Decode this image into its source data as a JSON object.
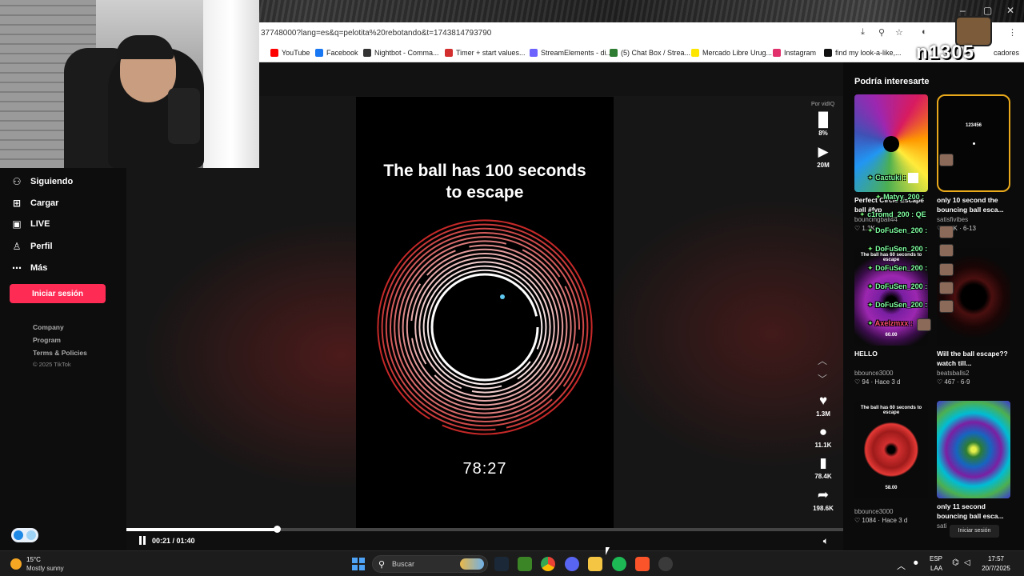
{
  "browser": {
    "address": "37748000?lang=es&q=pelotita%20rebotando&t=1743814793790",
    "bookmarks": [
      {
        "label": "YouTube",
        "color": "#ff0000"
      },
      {
        "label": "Facebook",
        "color": "#1877f2"
      },
      {
        "label": "Nightbot - Comma...",
        "color": "#333333"
      },
      {
        "label": "Timer + start values...",
        "color": "#d32f2f"
      },
      {
        "label": "StreamElements - di...",
        "color": "#6c63ff"
      },
      {
        "label": "(5) Chat Box / Strea...",
        "color": "#2e7d32"
      },
      {
        "label": "Mercado Libre Urug...",
        "color": "#ffe600"
      },
      {
        "label": "Instagram",
        "color": "#e1306c"
      },
      {
        "label": "find my look-a-like,...",
        "color": "#111111"
      }
    ],
    "bookmarks_overflow": "»",
    "bookmarks_folder": "cadores"
  },
  "stream_overlay": {
    "brand": "n1305"
  },
  "sidebar": {
    "items": [
      {
        "label": "Siguiendo",
        "icon": "user-icon"
      },
      {
        "label": "Cargar",
        "icon": "plus-box-icon"
      },
      {
        "label": "LIVE",
        "icon": "live-tv-icon"
      },
      {
        "label": "Perfil",
        "icon": "person-icon"
      },
      {
        "label": "Más",
        "icon": "more-icon"
      }
    ],
    "login_button": "Iniciar sesión",
    "footer_links": [
      "Company",
      "Program",
      "Terms & Policies"
    ],
    "copyright": "© 2025 TikTok"
  },
  "video": {
    "title_line1": "The ball has 100 seconds",
    "title_line2": "to escape",
    "timer": "78:27",
    "elapsed": "00:21",
    "duration": "01:40",
    "progress_fraction": 0.21
  },
  "rail": {
    "sponsor": "Por vidIQ",
    "stats_pct": "8%",
    "views": "20M",
    "likes": "1.3M",
    "comments": "11.1K",
    "saves": "78.4K",
    "shares": "198.6K"
  },
  "recs": {
    "title": "Podría interesarte",
    "cards": [
      {
        "title": "Perfect Circle Escape ball #fyp",
        "author": "bouncingball44",
        "meta": "1.3K"
      },
      {
        "title": "only 10 second the bouncing ball esca...",
        "author": "satisfivibes",
        "meta": "5.4K · 6-13"
      },
      {
        "title": "HELLO",
        "author": "bbounce3000",
        "meta": "94 · Hace 3 d"
      },
      {
        "title": "Will the ball escape?? watch till...",
        "author": "beatsballs2",
        "meta": "467 · 6-9"
      },
      {
        "title": "",
        "author": "bbounce3000",
        "meta": "1084 · Hace 3 d"
      },
      {
        "title": "only 11 second bouncing ball esca...",
        "author": "sati",
        "meta": ""
      }
    ],
    "thumb_texts": {
      "card1_top": "123456",
      "card3_top": "The ball has 60 seconds to escape",
      "card3_bottom": "60.00",
      "card5_top": "The ball has 60 seconds to escape",
      "card5_bottom": "58.00"
    },
    "login_chip": "Iniciar sesión"
  },
  "chat": [
    {
      "name": "Cactuki :",
      "color": "#ffffff"
    },
    {
      "name": "Matyy_200 :",
      "color": "#ffffff"
    },
    {
      "name": "c1romd_200 : QE",
      "color": "#7fffa0"
    },
    {
      "name": "DoFuSen_200 :",
      "color": "#7fffa0"
    },
    {
      "name": "DoFuSen_200 :",
      "color": "#7fffa0"
    },
    {
      "name": "DoFuSen_200 :",
      "color": "#7fffa0"
    },
    {
      "name": "DoFuSen_200 :",
      "color": "#7fffa0"
    },
    {
      "name": "DoFuSen_200 :",
      "color": "#7fffa0"
    },
    {
      "name": "Axelzmxx :",
      "color": "#ff4d6d"
    }
  ],
  "taskbar": {
    "temp": "15°C",
    "weather": "Mostly sunny",
    "search_placeholder": "Buscar",
    "lang1": "ESP",
    "lang2": "LAA",
    "time": "17:57",
    "date": "20/7/2025"
  },
  "colors": {
    "accent": "#fe2c55",
    "ring_outer": "#c62828",
    "ring_inner": "#ffffff",
    "ball": "#5ec8f0"
  }
}
